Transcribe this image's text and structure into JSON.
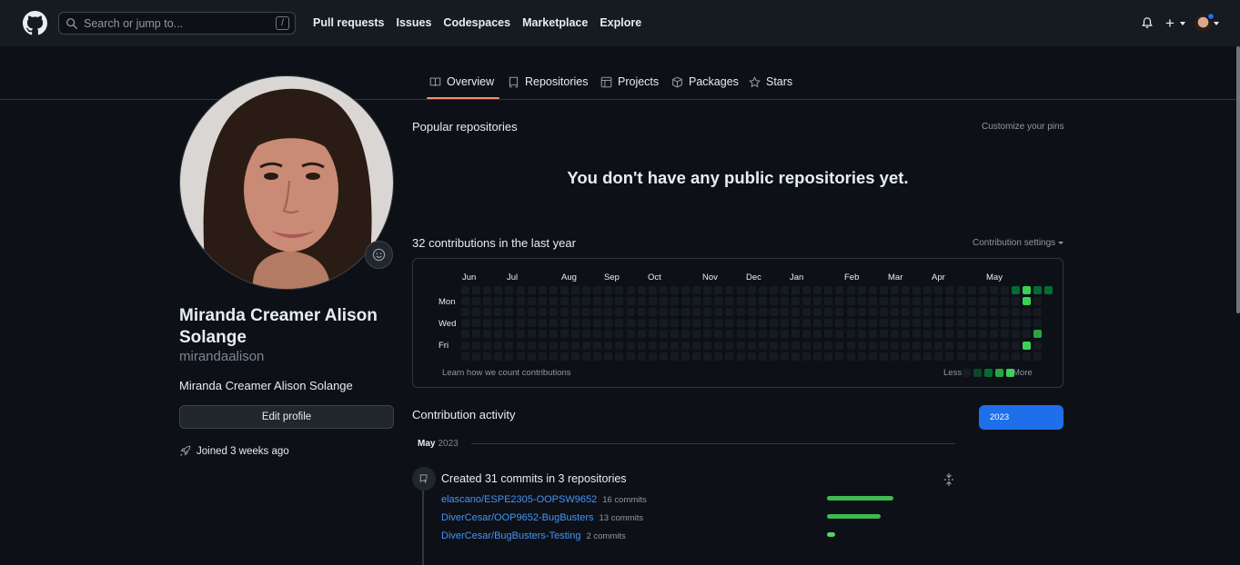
{
  "header": {
    "search_placeholder": "Search or jump to...",
    "search_shortcut": "/",
    "nav": [
      "Pull requests",
      "Issues",
      "Codespaces",
      "Marketplace",
      "Explore"
    ],
    "icons": [
      "github-logo-icon",
      "bell-icon",
      "plus-icon",
      "avatar-icon"
    ]
  },
  "tabs": [
    {
      "label": "Overview",
      "icon": "book-icon",
      "active": true
    },
    {
      "label": "Repositories",
      "icon": "repo-icon",
      "active": false
    },
    {
      "label": "Projects",
      "icon": "table-icon",
      "active": false
    },
    {
      "label": "Packages",
      "icon": "package-icon",
      "active": false
    },
    {
      "label": "Stars",
      "icon": "star-icon",
      "active": false
    }
  ],
  "profile": {
    "full_name": "Miranda Creamer Alison Solange",
    "login": "mirandaalison",
    "bio": "Miranda Creamer Alison Solange",
    "edit_label": "Edit profile",
    "joined": "Joined 3 weeks ago"
  },
  "popular": {
    "title": "Popular repositories",
    "customize": "Customize your pins",
    "empty": "You don't have any public repositories yet."
  },
  "contributions": {
    "title": "32 contributions in the last year",
    "settings": "Contribution settings",
    "months": [
      "Jun",
      "Jul",
      "Aug",
      "Sep",
      "Oct",
      "Nov",
      "Dec",
      "Jan",
      "Feb",
      "Mar",
      "Apr",
      "May"
    ],
    "weekdays": [
      "Mon",
      "Wed",
      "Fri"
    ],
    "learn": "Learn how we count contributions",
    "less": "Less",
    "more": "More",
    "colors": [
      "#161b22",
      "#0e4429",
      "#006d32",
      "#26a641",
      "#39d353"
    ],
    "active_cells": [
      {
        "week": 50,
        "day": 0,
        "level": 2
      },
      {
        "week": 51,
        "day": 0,
        "level": 4
      },
      {
        "week": 52,
        "day": 0,
        "level": 2
      },
      {
        "week": 53,
        "day": 0,
        "level": 2
      },
      {
        "week": 51,
        "day": 1,
        "level": 4
      },
      {
        "week": 52,
        "day": 4,
        "level": 3
      },
      {
        "week": 51,
        "day": 5,
        "level": 4
      }
    ]
  },
  "activity": {
    "title": "Contribution activity",
    "year": "2023",
    "month": "May",
    "month_year": "2023",
    "summary": "Created 31 commits in 3 repositories",
    "repos": [
      {
        "name": "elascano/ESPE2305-OOPSW9652",
        "commits": "16 commits",
        "value": 16
      },
      {
        "name": "DiverCesar/OOP9652-BugBusters",
        "commits": "13 commits",
        "value": 13
      },
      {
        "name": "DiverCesar/BugBusters-Testing",
        "commits": "2 commits",
        "value": 2
      }
    ],
    "bar_colors": [
      "#3fb950",
      "#3fb950",
      "#56d364"
    ]
  }
}
